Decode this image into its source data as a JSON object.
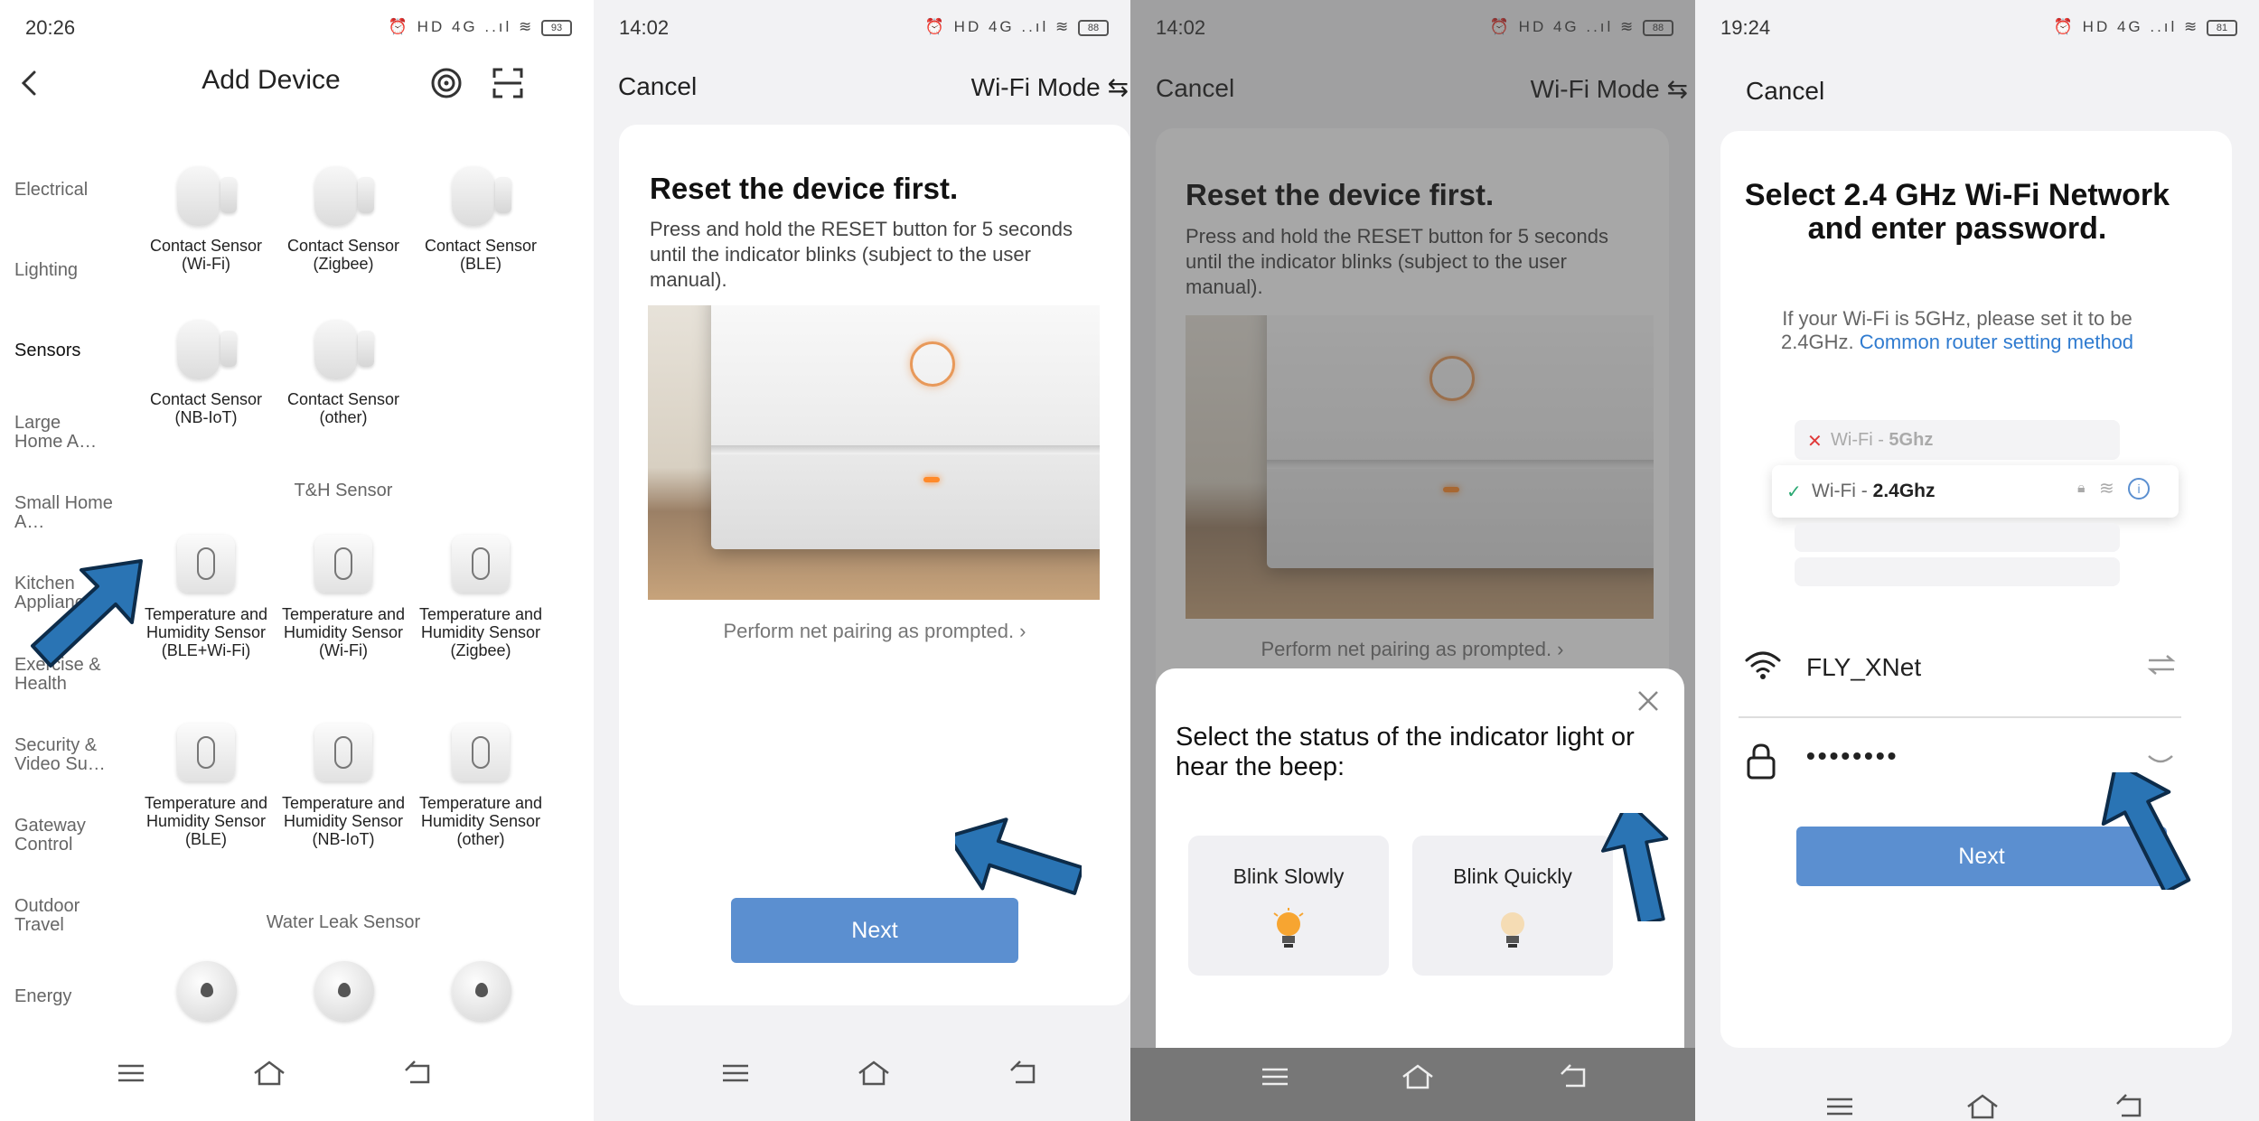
{
  "panel1": {
    "status": {
      "time": "20:26",
      "icons": "⏰ HD 4G ..ıl ≋",
      "battery": "93"
    },
    "title": "Add Device",
    "sidebar": [
      {
        "label": "Electrical",
        "active": false
      },
      {
        "label": "Lighting",
        "active": false
      },
      {
        "label": "Sensors",
        "active": true
      },
      {
        "label": "Large Home A…",
        "active": false
      },
      {
        "label": "Small Home A…",
        "active": false
      },
      {
        "label": "Kitchen Appliances",
        "active": false
      },
      {
        "label": "Exercise & Health",
        "active": false
      },
      {
        "label": "Security & Video Su…",
        "active": false
      },
      {
        "label": "Gateway Control",
        "active": false
      },
      {
        "label": "Outdoor Travel",
        "active": false
      },
      {
        "label": "Energy",
        "active": false
      }
    ],
    "contact_devices": [
      {
        "label": "Contact Sensor (Wi-Fi)"
      },
      {
        "label": "Contact Sensor (Zigbee)"
      },
      {
        "label": "Contact Sensor (BLE)"
      },
      {
        "label": "Contact Sensor (NB-IoT)"
      },
      {
        "label": "Contact Sensor (other)"
      }
    ],
    "th_header": "T&H Sensor",
    "th_devices": [
      {
        "label": "Temperature and Humidity Sensor (BLE+Wi-Fi)"
      },
      {
        "label": "Temperature and Humidity Sensor (Wi-Fi)"
      },
      {
        "label": "Temperature and Humidity Sensor (Zigbee)"
      },
      {
        "label": "Temperature and Humidity Sensor (BLE)"
      },
      {
        "label": "Temperature and Humidity Sensor (NB-IoT)"
      },
      {
        "label": "Temperature and Humidity Sensor (other)"
      }
    ],
    "leak_header": "Water Leak Sensor"
  },
  "panel2": {
    "status": {
      "time": "14:02",
      "icons": "⏰ HD 4G ..ıl ≋",
      "battery": "88"
    },
    "cancel": "Cancel",
    "mode": "Wi-Fi Mode ⇆",
    "heading": "Reset the device first.",
    "desc": "Press and hold the RESET button for 5 seconds until the indicator blinks (subject to the user manual).",
    "hint": "Perform net pairing as prompted. ›",
    "next": "Next"
  },
  "panel3": {
    "status": {
      "time": "14:02",
      "icons": "⏰ HD 4G ..ıl ≋",
      "battery": "88"
    },
    "cancel": "Cancel",
    "mode": "Wi-Fi Mode ⇆",
    "heading": "Reset the device first.",
    "desc": "Press and hold the RESET button for 5 seconds until the indicator blinks (subject to the user manual).",
    "hint": "Perform net pairing as prompted. ›",
    "sheet_question": "Select the status of the indicator light or hear the beep:",
    "option_slow": "Blink Slowly",
    "option_quick": "Blink Quickly"
  },
  "panel4": {
    "status": {
      "time": "19:24",
      "icons": "⏰ HD 4G ..ıl ≋",
      "battery": "81"
    },
    "cancel": "Cancel",
    "title": "Select 2.4 GHz Wi-Fi Network and enter password.",
    "sub_prefix": "If your Wi-Fi is 5GHz, please set it to be 2.4GHz.",
    "sub_link": "Common router setting method",
    "net_5_prefix": "Wi-Fi - ",
    "net_5_band": "5Ghz",
    "net_24_prefix": "Wi-Fi - ",
    "net_24_band": "2.4Ghz",
    "ssid": "FLY_XNet",
    "password": "••••••••",
    "next": "Next"
  },
  "colors": {
    "accent": "#5b8fd0",
    "link": "#2f7bd0",
    "arrow": "#2a74b4"
  }
}
